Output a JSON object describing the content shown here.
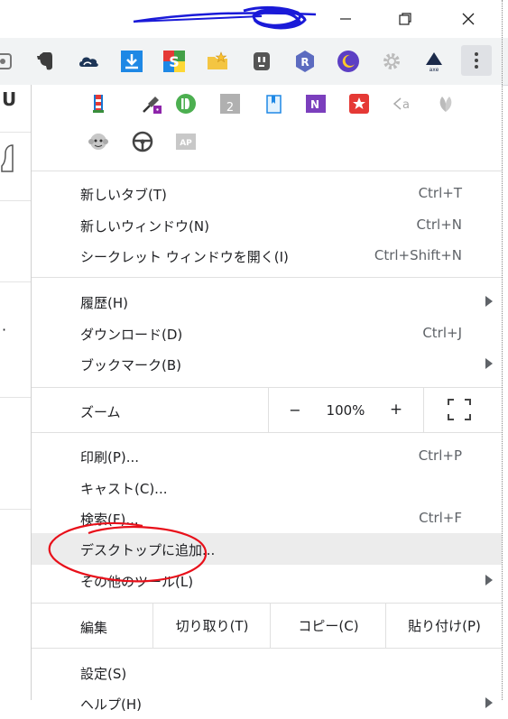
{
  "window": {
    "controls": {
      "minimize": "minimize-icon",
      "maximize": "restore-icon",
      "close": "close-icon"
    }
  },
  "toolbar": {
    "extensions": [
      "page-capture-icon",
      "evernote-icon",
      "cloud-icon",
      "download-icon",
      "s-app-icon",
      "folder-star-icon",
      "plug-icon",
      "r-extension-icon",
      "moon-icon",
      "gear-icon",
      "axe-icon"
    ],
    "menu_icon": "more-vert-icon"
  },
  "menu": {
    "hidden_extensions": [
      "lighthouse-icon",
      "eyedropper-icon",
      "pushbullet-icon",
      "nullpo-icon",
      "bookmark-icon",
      "onenote-icon",
      "save-star-icon",
      "codecomment-icon",
      "leaf-icon",
      "monkey-icon",
      "steering-icon",
      "ap-icon"
    ],
    "items": {
      "new_tab": {
        "label": "新しいタブ(T)",
        "shortcut": "Ctrl+T"
      },
      "new_window": {
        "label": "新しいウィンドウ(N)",
        "shortcut": "Ctrl+N"
      },
      "incognito": {
        "label": "シークレット ウィンドウを開く(I)",
        "shortcut": "Ctrl+Shift+N"
      },
      "history": {
        "label": "履歴(H)"
      },
      "downloads": {
        "label": "ダウンロード(D)",
        "shortcut": "Ctrl+J"
      },
      "bookmarks": {
        "label": "ブックマーク(B)"
      },
      "print": {
        "label": "印刷(P)...",
        "shortcut": "Ctrl+P"
      },
      "cast": {
        "label": "キャスト(C)..."
      },
      "find": {
        "label": "検索(F)...",
        "shortcut": "Ctrl+F"
      },
      "add_to_desktop": {
        "label": "デスクトップに追加..."
      },
      "more_tools": {
        "label": "その他のツール(L)"
      },
      "settings": {
        "label": "設定(S)"
      },
      "help": {
        "label": "ヘルプ(H)"
      }
    },
    "zoom": {
      "label": "ズーム",
      "minus": "−",
      "value": "100%",
      "plus": "+"
    },
    "edit": {
      "label": "編集",
      "cut": "切り取り(T)",
      "copy": "コピー(C)",
      "paste": "貼り付け(P)"
    }
  },
  "page_left": {
    "fragment": "U",
    "dot": "·"
  },
  "colors": {
    "annotation_red": "#e8101a",
    "scribble_blue": "#1a1ad8",
    "menu_highlight": "#ececec"
  }
}
